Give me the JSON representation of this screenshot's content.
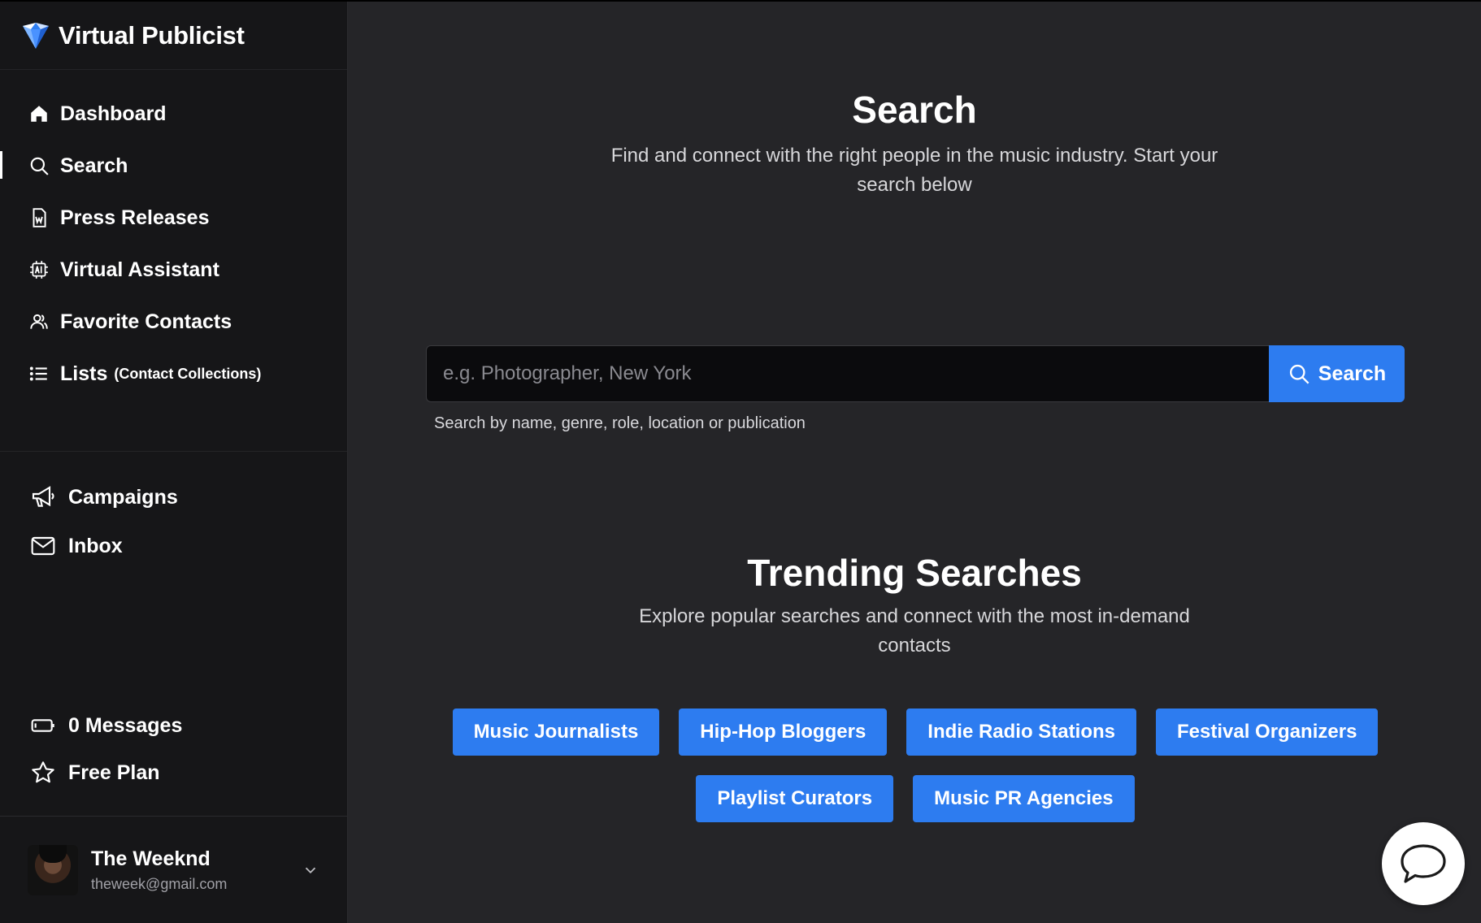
{
  "brand": {
    "name": "Virtual Publicist"
  },
  "nav": {
    "primary": [
      {
        "label": "Dashboard",
        "icon": "home-icon"
      },
      {
        "label": "Search",
        "icon": "search-icon"
      },
      {
        "label": "Press Releases",
        "icon": "document-icon"
      },
      {
        "label": "Virtual Assistant",
        "icon": "ai-chip-icon"
      },
      {
        "label": "Favorite Contacts",
        "icon": "contacts-icon"
      },
      {
        "label": "Lists",
        "sub": "(Contact Collections)",
        "icon": "list-icon"
      }
    ],
    "secondary": [
      {
        "label": "Campaigns",
        "icon": "megaphone-icon"
      },
      {
        "label": "Inbox",
        "icon": "mail-icon"
      }
    ],
    "account": [
      {
        "label": "0 Messages",
        "icon": "battery-icon"
      },
      {
        "label": "Free Plan",
        "icon": "star-icon"
      }
    ]
  },
  "user": {
    "name": "The Weeknd",
    "email": "theweek@gmail.com"
  },
  "search": {
    "title": "Search",
    "subtitle": "Find and connect with the right people in the music industry. Start your search below",
    "placeholder": "e.g. Photographer, New York",
    "button_label": "Search",
    "help": "Search by name, genre, role, location or publication"
  },
  "trending": {
    "title": "Trending Searches",
    "subtitle": "Explore popular searches and connect with the most in-demand contacts",
    "row1": [
      "Music Journalists",
      "Hip-Hop Bloggers",
      "Indie Radio Stations",
      "Festival Organizers"
    ],
    "row2": [
      "Playlist Curators",
      "Music PR Agencies"
    ]
  },
  "colors": {
    "accent": "#2d7cf0",
    "sidebar_bg": "#161618",
    "main_bg": "#252528"
  }
}
